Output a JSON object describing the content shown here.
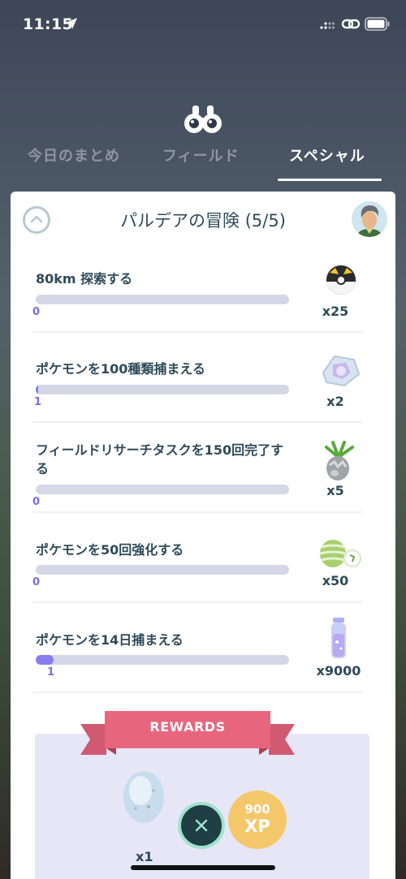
{
  "status_bar": {
    "time": "11:15"
  },
  "tabs": [
    {
      "label": "今日のまとめ"
    },
    {
      "label": "フィールド"
    },
    {
      "label": "スペシャル"
    }
  ],
  "research": {
    "title": "パルデアの冒険 (5/5)",
    "tasks": [
      {
        "name": "80km 探索する",
        "progress": "0",
        "progress_fraction": 0,
        "reward_qty": "x25",
        "reward_icon": "ultra-ball-icon"
      },
      {
        "name": "ポケモンを100種類捕まえる",
        "progress": "1",
        "progress_fraction": 0.01,
        "reward_qty": "x2",
        "reward_icon": "star-piece-icon"
      },
      {
        "name": "フィールドリサーチタスクを150回完了する",
        "progress": "0",
        "progress_fraction": 0,
        "reward_qty": "x5",
        "reward_icon": "silver-pinap-berry-icon"
      },
      {
        "name": "ポケモンを50回強化する",
        "progress": "0",
        "progress_fraction": 0,
        "reward_qty": "x50",
        "reward_icon": "pokemon-candy-icon"
      },
      {
        "name": "ポケモンを14日捕まえる",
        "progress": "1",
        "progress_fraction": 0.07,
        "reward_qty": "x9000",
        "reward_icon": "stardust-icon"
      }
    ]
  },
  "rewards": {
    "label": "REWARDS",
    "egg_qty": "x1",
    "xp_amount": "900",
    "xp_label": "XP"
  }
}
